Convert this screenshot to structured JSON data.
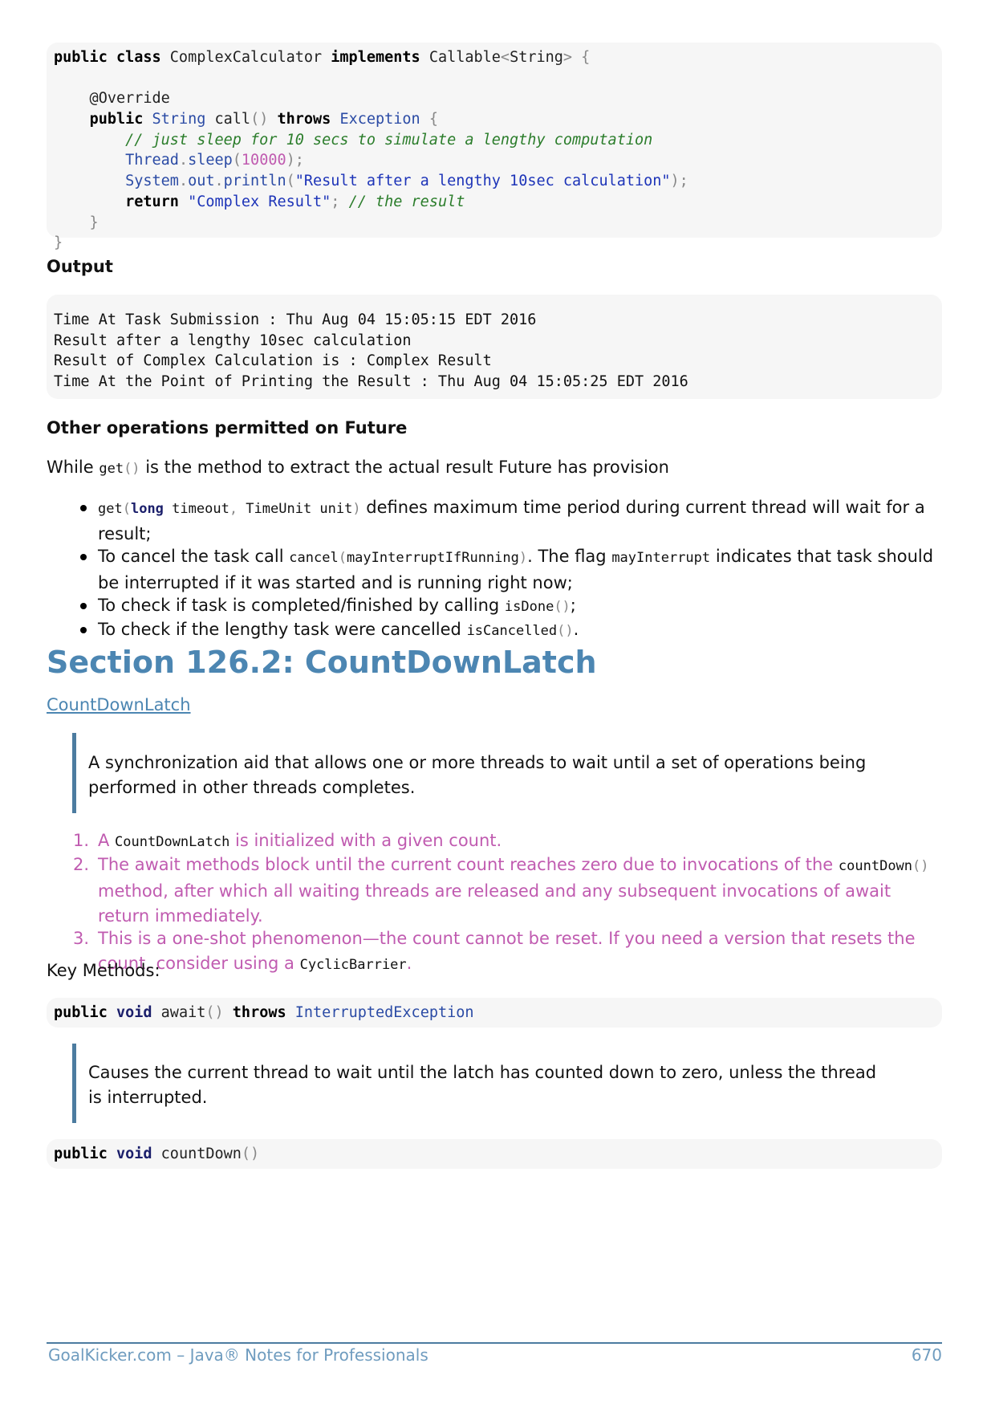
{
  "code1": {
    "lines": [
      [
        {
          "t": "public class ",
          "c": "kw"
        },
        {
          "t": "ComplexCalculator ",
          "c": ""
        },
        {
          "t": "implements ",
          "c": "kw"
        },
        {
          "t": "Callable",
          "c": ""
        },
        {
          "t": "<",
          "c": "pun"
        },
        {
          "t": "String",
          "c": ""
        },
        {
          "t": "> {",
          "c": "pun"
        }
      ],
      [],
      [
        {
          "t": "    @Override",
          "c": ""
        }
      ],
      [
        {
          "t": "    ",
          "c": ""
        },
        {
          "t": "public ",
          "c": "kw"
        },
        {
          "t": "String ",
          "c": "typ"
        },
        {
          "t": "call",
          "c": ""
        },
        {
          "t": "() ",
          "c": "pun"
        },
        {
          "t": "throws ",
          "c": "kw"
        },
        {
          "t": "Exception ",
          "c": "typ"
        },
        {
          "t": "{",
          "c": "pun"
        }
      ],
      [
        {
          "t": "        // just sleep for 10 secs to simulate a lengthy computation",
          "c": "com"
        }
      ],
      [
        {
          "t": "        ",
          "c": ""
        },
        {
          "t": "Thread",
          "c": "typ"
        },
        {
          "t": ".",
          "c": "pun"
        },
        {
          "t": "sleep",
          "c": "typ"
        },
        {
          "t": "(",
          "c": "pun"
        },
        {
          "t": "10000",
          "c": "num"
        },
        {
          "t": ");",
          "c": "pun"
        }
      ],
      [
        {
          "t": "        ",
          "c": ""
        },
        {
          "t": "System",
          "c": "typ"
        },
        {
          "t": ".",
          "c": "pun"
        },
        {
          "t": "out",
          "c": "typ"
        },
        {
          "t": ".",
          "c": "pun"
        },
        {
          "t": "println",
          "c": "typ"
        },
        {
          "t": "(",
          "c": "pun"
        },
        {
          "t": "\"Result after a lengthy 10sec calculation\"",
          "c": "str"
        },
        {
          "t": ");",
          "c": "pun"
        }
      ],
      [
        {
          "t": "        ",
          "c": ""
        },
        {
          "t": "return ",
          "c": "kw"
        },
        {
          "t": "\"Complex Result\"",
          "c": "str"
        },
        {
          "t": "; ",
          "c": "pun"
        },
        {
          "t": "// the result",
          "c": "com"
        }
      ],
      [
        {
          "t": "    }",
          "c": "pun"
        }
      ],
      [
        {
          "t": "}",
          "c": "pun"
        }
      ]
    ]
  },
  "output_heading": "Output",
  "output_lines": [
    "Time At Task Submission : Thu Aug 04 15:05:15 EDT 2016",
    "Result after a lengthy 10sec calculation",
    "Result of Complex Calculation is : Complex Result",
    "Time At the Point of Printing the Result : Thu Aug 04 15:05:25 EDT 2016"
  ],
  "other_ops_heading": "Other operations permitted on Future",
  "intro": {
    "before": "While ",
    "code": "get",
    "code_pun": "()",
    "after": " is the method to extract the actual result Future has provision"
  },
  "bullets": [
    {
      "parts": [
        {
          "t": "get",
          "k": "code"
        },
        {
          "t": "(",
          "k": "pun"
        },
        {
          "t": "long",
          "k": "kw2"
        },
        {
          "t": " timeout",
          "k": "code"
        },
        {
          "t": ", ",
          "k": "pun"
        },
        {
          "t": "TimeUnit unit",
          "k": "code"
        },
        {
          "t": ")",
          "k": "pun"
        },
        {
          "t": " defines maximum time period during current thread will wait for a result;",
          "k": "text"
        }
      ]
    },
    {
      "parts": [
        {
          "t": "To cancel the task call ",
          "k": "text"
        },
        {
          "t": "cancel",
          "k": "code"
        },
        {
          "t": "(",
          "k": "pun"
        },
        {
          "t": "mayInterruptIfRunning",
          "k": "code"
        },
        {
          "t": ")",
          "k": "pun"
        },
        {
          "t": ". The flag ",
          "k": "text"
        },
        {
          "t": "mayInterrupt",
          "k": "code"
        },
        {
          "t": " indicates that task should be interrupted if it was started and is running right now;",
          "k": "text"
        }
      ]
    },
    {
      "parts": [
        {
          "t": "To check if task is completed/finished by calling ",
          "k": "text"
        },
        {
          "t": "isDone",
          "k": "code"
        },
        {
          "t": "()",
          "k": "pun"
        },
        {
          "t": ";",
          "k": "text"
        }
      ]
    },
    {
      "parts": [
        {
          "t": "To check if the lengthy task were cancelled ",
          "k": "text"
        },
        {
          "t": "isCancelled",
          "k": "code"
        },
        {
          "t": "()",
          "k": "pun"
        },
        {
          "t": ".",
          "k": "text"
        }
      ]
    }
  ],
  "section_title": "Section 126.2: CountDownLatch",
  "section_link": "CountDownLatch",
  "quote1": "A synchronization aid that allows one or more threads to wait until a set of operations being performed in other threads completes.",
  "numbered": [
    {
      "num": "1.",
      "parts": [
        {
          "t": "A ",
          "k": "text"
        },
        {
          "t": "CountDownLatch",
          "k": "code"
        },
        {
          "t": " is initialized with a given count.",
          "k": "text"
        }
      ]
    },
    {
      "num": "2.",
      "parts": [
        {
          "t": "The await methods block until the current count reaches zero due to invocations of the ",
          "k": "text"
        },
        {
          "t": "countDown",
          "k": "code"
        },
        {
          "t": "()",
          "k": "pun"
        },
        {
          "t": " method, after which all waiting threads are released and any subsequent invocations of await return immediately.",
          "k": "text"
        }
      ]
    },
    {
      "num": "3.",
      "parts": [
        {
          "t": "This is a one-shot phenomenon—the count cannot be reset. If you need a version that resets the count, consider using a ",
          "k": "text"
        },
        {
          "t": "CyclicBarrier",
          "k": "code"
        },
        {
          "t": ".",
          "k": "text"
        }
      ]
    }
  ],
  "key_methods": "Key Methods:",
  "code2": [
    {
      "t": "public ",
      "c": "kw"
    },
    {
      "t": "void ",
      "c": "kw2"
    },
    {
      "t": "await",
      "c": ""
    },
    {
      "t": "() ",
      "c": "pun"
    },
    {
      "t": "throws ",
      "c": "kw"
    },
    {
      "t": "InterruptedException",
      "c": "typ"
    }
  ],
  "quote2": "Causes the current thread to wait until the latch has counted down to zero, unless the thread is interrupted.",
  "code3": [
    {
      "t": "public ",
      "c": "kw"
    },
    {
      "t": "void ",
      "c": "kw2"
    },
    {
      "t": "countDown",
      "c": ""
    },
    {
      "t": "()",
      "c": "pun"
    }
  ],
  "footer": {
    "left": "GoalKicker.com – Java® Notes for Professionals",
    "right": "670"
  }
}
